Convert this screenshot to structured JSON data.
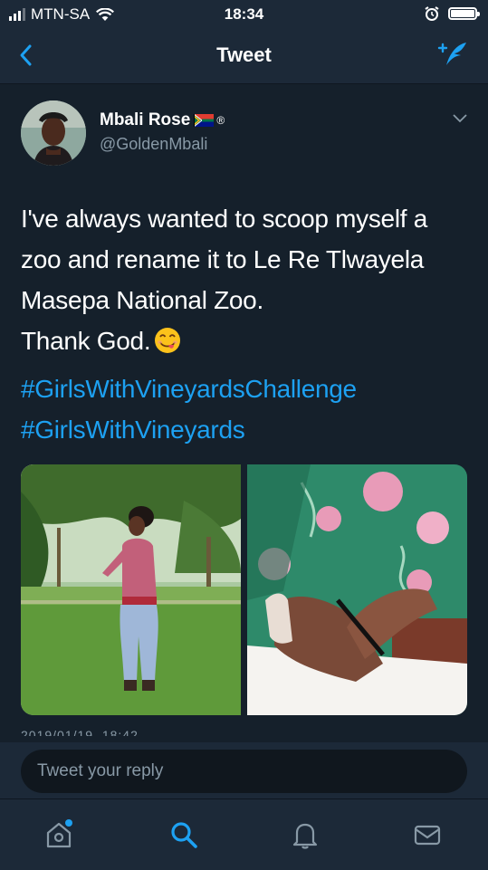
{
  "status_bar": {
    "carrier": "MTN-SA",
    "time": "18:34"
  },
  "nav": {
    "title": "Tweet"
  },
  "tweet": {
    "author_name": "Mbali Rose",
    "author_badge": "®",
    "handle": "@GoldenMbali",
    "text_lines": [
      "I've always wanted to scoop myself a",
      "zoo and rename it to Le Re Tlwayela",
      "Masepa National Zoo."
    ],
    "last_line": "Thank God.",
    "hashtags": [
      "#GirlsWithVineyardsChallenge",
      "#GirlsWithVineyards"
    ],
    "timestamp": "2019/01/19, 18:42"
  },
  "reply": {
    "placeholder": "Tweet your reply"
  },
  "colors": {
    "background": "#15202b",
    "bar": "#1c2938",
    "accent": "#1da1f2",
    "secondary_text": "#8899a6"
  },
  "icons": {
    "back": "chevron-left-icon",
    "compose": "compose-tweet-icon",
    "more": "chevron-down-icon",
    "home": "home-icon",
    "search": "search-icon",
    "notifications": "bell-icon",
    "messages": "mail-icon"
  }
}
